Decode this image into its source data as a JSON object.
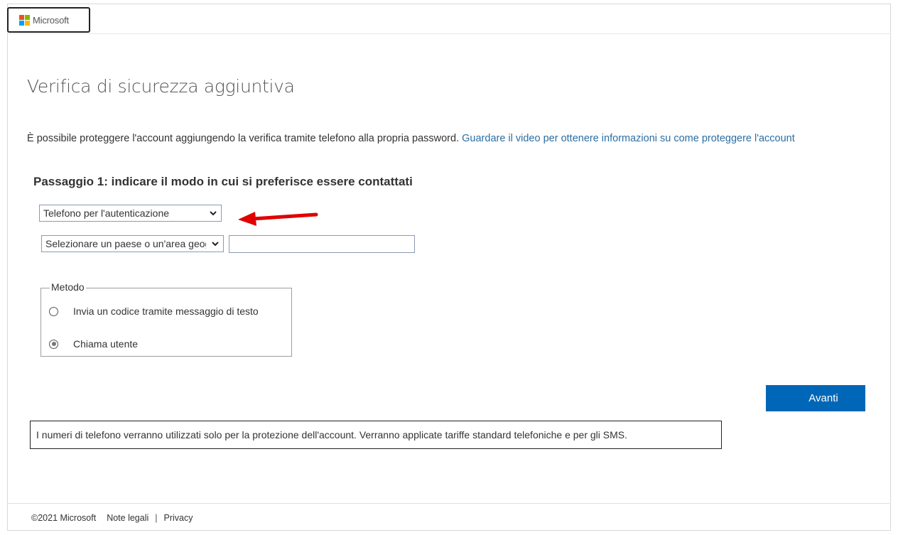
{
  "header": {
    "logo_text": "Microsoft",
    "logo_colors": [
      "#f25022",
      "#7fba00",
      "#00a4ef",
      "#ffb900"
    ]
  },
  "main": {
    "title": "Verifica di sicurezza aggiuntiva",
    "intro_text": "È possibile proteggere l'account aggiungendo la verifica tramite telefono alla propria password.",
    "intro_link": "Guardare il video per ottenere informazioni su come proteggere l'account",
    "step_title": "Passaggio 1: indicare il modo in cui si preferisce essere contattati",
    "auth_method_select": "Telefono per l'autenticazione",
    "country_select": "Selezionare un paese o un'area geografica",
    "phone_value": "",
    "method": {
      "legend": "Metodo",
      "options": [
        {
          "label": "Invia un codice tramite messaggio di testo",
          "checked": false
        },
        {
          "label": "Chiama utente",
          "checked": true
        }
      ]
    },
    "next_button": "Avanti",
    "note": "I numeri di telefono verranno utilizzati solo per la protezione dell'account. Verranno applicate tariffe standard telefoniche e per gli SMS."
  },
  "footer": {
    "copyright": "©2021 Microsoft",
    "legal_link": "Note legali",
    "separator": "|",
    "privacy_link": "Privacy"
  },
  "colors": {
    "accent": "#0067b8",
    "link": "#2b6ea3",
    "annotation_arrow": "#e00000"
  }
}
